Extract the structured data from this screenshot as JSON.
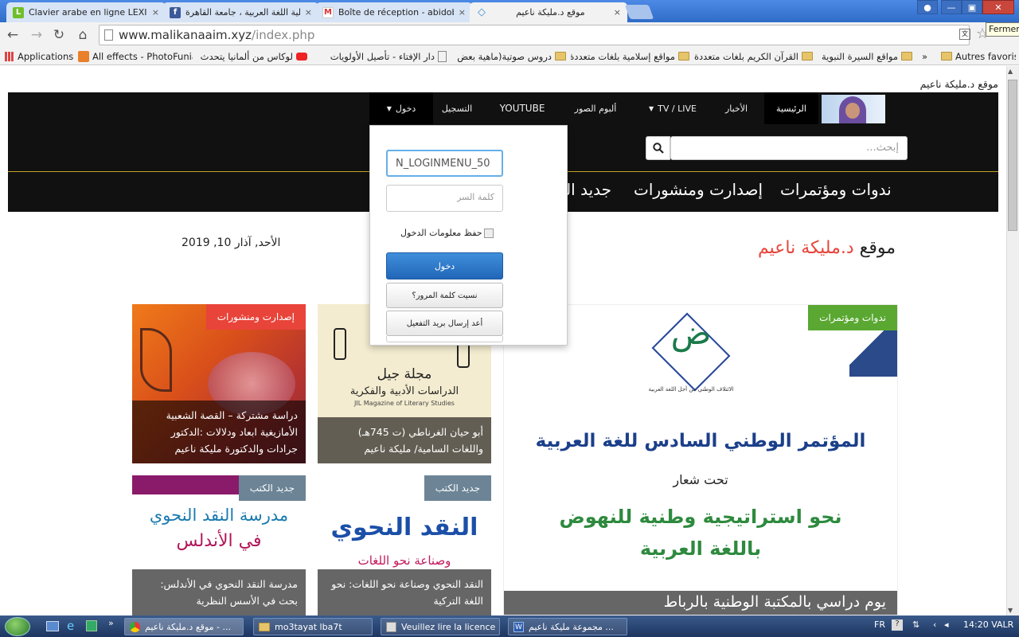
{
  "browser": {
    "tabs": [
      {
        "title": "Clavier arabe en ligne LEXILOGOS",
        "favicon": "L",
        "color": "#6fbf2a"
      },
      {
        "title": "كلية اللغة العربية ، جامعة القاهرة",
        "favicon": "f",
        "color": "#3b5998"
      },
      {
        "title": "Boîte de réception - abidobel",
        "favicon": "M",
        "color": "#d33"
      },
      {
        "title": "موقع د.مليكة ناعيم",
        "favicon": "◇",
        "color": "#3a8fd6"
      }
    ],
    "tab_close": "×",
    "url_host": "www.malikanaaim.xyz",
    "url_path": "/index.php",
    "tooltip": "Fermer"
  },
  "bookmarks": {
    "items": [
      {
        "label": "Applications",
        "icon": "apps-grid-icon"
      },
      {
        "label": "All effects - PhotoFunia",
        "icon": "photofunia-icon"
      },
      {
        "label": "لوكاس من ألمانيا يتحدث",
        "icon": "youtube-icon"
      },
      {
        "label": "دار الإفتاء - تأصيل الأولويات",
        "icon": "page-icon"
      },
      {
        "label": "دروس صوتية(ماهية بعض",
        "icon": "folder-icon"
      },
      {
        "label": "مواقع إسلامية بلغات متعددة",
        "icon": "folder-icon"
      },
      {
        "label": "القرآن الكريم بلغات متعددة",
        "icon": "folder-icon"
      },
      {
        "label": "مواقع السيرة النبوية",
        "icon": "folder-icon"
      }
    ],
    "more": "»",
    "other": "Autres favoris"
  },
  "site": {
    "top_title": "موقع د.مليكة ناعيم",
    "nav": [
      {
        "label": "الرئيسية",
        "active": true
      },
      {
        "label": "الأخبار"
      },
      {
        "label": "TV / LIVE",
        "dropdown": true
      },
      {
        "label": "ألبوم الصور"
      },
      {
        "label": "YOUTUBE"
      },
      {
        "label": "التسجيل"
      },
      {
        "label": "دخول",
        "dropdown": true
      }
    ],
    "search_placeholder": "إبحث...",
    "menu2": [
      "ندوات ومؤتمرات",
      "إصدارت ومنشورات",
      "جديد الكتب"
    ],
    "brand_prefix": "موقع ",
    "brand_name": "د.مليكة ناعيم",
    "date": "الأحد, آذار 10, 2019",
    "login": {
      "username_value": "N_LOGINMENU_50",
      "password_placeholder": "كلمة السر",
      "remember_label": "حفظ معلومات الدخول",
      "submit": "دخول",
      "forgot": "نسيت كلمة المرور؟",
      "resend": "أعد إرسال بريد التفعيل"
    },
    "cards": [
      {
        "badge": "إصدارت ومنشورات",
        "badge_color": "#e8443a",
        "caption": "دراسة مشتركة – القصة الشعبية الأمازيغية ابعاد ودلالات :الدكتور جرادات والدكتورة مليكة ناعيم"
      },
      {
        "badge": "",
        "caption": "أبو حيان الغرناطي (ت 745هـ) واللغات السامية/ مليكة ناعيم",
        "cover_title": "مجلة جيل",
        "cover_sub": "الدراسات الأدبية والفكرية",
        "cover_en": "JIL Magazine of Literary Studies"
      },
      {
        "badge": "جديد الكتب",
        "badge_color": "#6c8496",
        "caption": "مدرسة النقد النحوي في الأندلس: بحث في الأسس النظرية",
        "cover_title": "مدرسة النقد النحوي",
        "cover_sub": "في الأندلس"
      },
      {
        "badge": "جديد الكتب",
        "badge_color": "#6c8496",
        "caption": "النقد النحوي وصناعة نحو اللغات: نحو اللغة التركية",
        "cover_title": "النقد النحوي",
        "cover_sub": "وصناعة نحو اللغات"
      },
      {
        "badge": "ندوات ومؤتمرات",
        "badge_color": "#5aa832",
        "caption": "يوم دراسي بالمكتبة الوطنية بالرباط",
        "logo_char": "ض",
        "logo_sub": "الائتلاف الوطني من أجل اللغة العربية",
        "poster_title": "المؤتمر الوطني السادس للغة العربية",
        "poster_sub": "تحت شعار",
        "poster_slogan1": "نحو استراتيجية وطنية للنهوض",
        "poster_slogan2": "باللغة العربية"
      }
    ]
  },
  "taskbar": {
    "items": [
      {
        "label": "موقع د.مليكة ناعيم - ...",
        "icon": "chrome-icon"
      },
      {
        "label": "mo3tayat lba7t",
        "icon": "folder-icon"
      },
      {
        "label": "Veuillez lire la licence ...",
        "icon": "installer-icon"
      },
      {
        "label": "مجموعة مليكة ناعيم ...",
        "icon": "word-icon"
      }
    ],
    "lang": "FR",
    "time": "14:20",
    "kb": "VALR"
  }
}
